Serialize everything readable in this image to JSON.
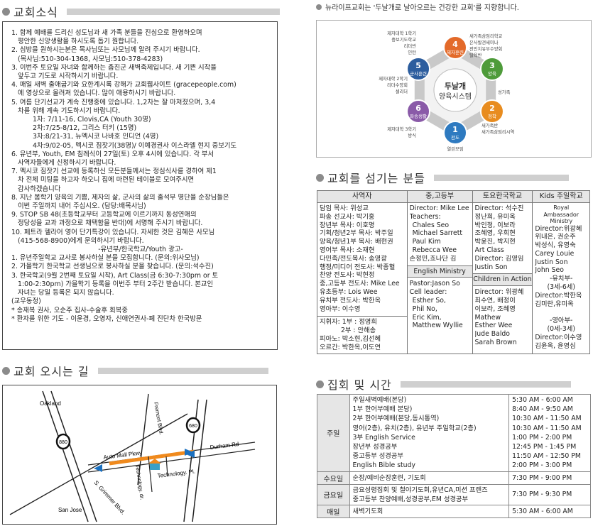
{
  "notices": {
    "title": "교회소식",
    "lines": [
      {
        "t": "1. 함께 예배를 드리신 성도님과 새 가족 분들을 진심으로 환영하오며",
        "i": 0
      },
      {
        "t": "평안한 신앙생활을 하시도록 돕기 원합니다.",
        "i": 1
      },
      {
        "t": "2. 심방을 원하시는분은 목사님또는 사모님께 알려 주시기 바랍니다.",
        "i": 0
      },
      {
        "t": "(목사님:510-304-1368, 사모님:510-378-4283)",
        "i": 1
      },
      {
        "t": "3. 이번주 토요일 자녀와 함께하는 촘진군 새벽축제입니다. 새 기쁜 시작을",
        "i": 0
      },
      {
        "t": "앞두고 기도로 시작하시기 바랍니다.",
        "i": 1
      },
      {
        "t": "4. 매일 새벽 출애굽기와 요한계시록 강해가 교회웹사이트 (gracepeople.com)",
        "i": 0
      },
      {
        "t": "에 영상으로 올려져 있습니다. 많이 애용하시기 바랍니다.",
        "i": 1
      },
      {
        "t": "5. 여름 단기선교가 계속 진행중에 있습니다. 1,2차는 잘 마쳐졌으며, 3,4",
        "i": 0
      },
      {
        "t": "차를 위해 계속 기도하시기 바랍니다.",
        "i": 1
      },
      {
        "t": "1차: 7/11-16, Clovis,CA (Youth 30명)",
        "i": 2
      },
      {
        "t": "2차:7/25-8/12, 그리스 터키 (15명)",
        "i": 2
      },
      {
        "t": "3차:8/21-31, 뉴멕시코 나바호 인디언 (4명)",
        "i": 2
      },
      {
        "t": "4차:9/02-05, 멕시코 짐잣기(38명)/ 이예경권사 이스라엘 현지 중보기도",
        "i": 2
      },
      {
        "t": "6. 유년부, Youth, EM 침례식이 27일(토) 오후 4시에 있습니다. 각 부서",
        "i": 0
      },
      {
        "t": "사역자들에게 신청하시기 바랍니다.",
        "i": 1
      },
      {
        "t": "7. 멕시코 짐잣기 선교에 등록하신 모든분들께서는 정심식사를 경하여 제1",
        "i": 0
      },
      {
        "t": "차 전체 미팅을 하고자 하오니 집에 마련된 테이블로 모여주시면",
        "i": 1
      },
      {
        "t": "감사하겠습니다",
        "i": 1
      },
      {
        "t": "8. 지난 봄학기 양육의 기쁨, 제자의 삶, 군사의 삶의 출석부 명단을 순장님들은",
        "i": 0
      },
      {
        "t": "이번 주일까지 내어 주십시오. (담당:배목사님)",
        "i": 1
      },
      {
        "t": "9. STOP SB 48(초등학교부터 고등학교에 이르기까지 동성연애의",
        "i": 0
      },
      {
        "t": "정당성을 교과 과정으로 채택함을 반대)에 서명해 주시기 바랍니다.",
        "i": 1
      },
      {
        "t": "10. 페트라 헬라어 영어 단기특강이 있습니다. 자세한 것은 김혜은 사모님",
        "i": 0
      },
      {
        "t": "(415-568-8900)에게 문의하시기 바랍니다.",
        "i": 1
      },
      {
        "t": "-유년부/한국학교/Youth 광고-",
        "i": 3
      },
      {
        "t": "1. 유년주일학교 교사로 봉사하실 분을 모집합니다. (문의:위사모님)",
        "i": 0
      },
      {
        "t": "2. 가을학기 한국학교 선생님으로 봉사하실 분을 찾습니다. (문의:석수진)",
        "i": 0
      },
      {
        "t": "3. 한국학교(9월 2번째 토요일 시작), Art Class(금 6:30-7:30pm or 토",
        "i": 0
      },
      {
        "t": "1:00-2:30pm) 가을학기 등록을 이번주 부터 2주간 받습니다. 본교인",
        "i": 1
      },
      {
        "t": "자녀는 당일 등록은 되지 않습니다.",
        "i": 1
      },
      {
        "t": "(교우동정)",
        "i": 0
      },
      {
        "t": "* 송재복 권사, 오순주 집사-수술후 회복중",
        "i": 0
      },
      {
        "t": "* 환자를 위한 기도 - 이윤경, 오영자, 신애연권사-폐 진단차 한국방문",
        "i": 0
      }
    ]
  },
  "directions": {
    "title": "교회 오시는 길",
    "labels": {
      "oakland": "Oakland",
      "san_jose": "San Jose",
      "fremont": "Fremont Blvd.",
      "auto_mall": "Auto Mall Pkwy",
      "durham": "Durham Rd",
      "technology_pl": "Technology. Pl.",
      "technology_dr": "Technology. dr.",
      "grimmer": "S. Grimmer Blvd.",
      "hwy880": "880",
      "hwy680": "680"
    }
  },
  "vision": {
    "text": "뉴라이프교회는 '두날개로 날아오르는 건강한 교회'를 지향합니다.",
    "center_line1": "두날개",
    "center_line2": "양육시스템",
    "nodes": [
      {
        "num": "1",
        "label": "전도",
        "color": "#2e7ac0"
      },
      {
        "num": "2",
        "label": "정착",
        "color": "#e88c1f"
      },
      {
        "num": "3",
        "label": "양육",
        "color": "#4e9b3a"
      },
      {
        "num": "4",
        "label": "제자훈련",
        "color": "#e36a2a"
      },
      {
        "num": "5",
        "label": "군사훈련",
        "color": "#2c5d9e"
      },
      {
        "num": "6",
        "label": "파송생활",
        "color": "#8a5aa8"
      }
    ],
    "captions": {
      "bottom": "열린모임",
      "bottom_right": "새가족반\n새가족삼임리시역",
      "right_top": "성가족",
      "top_right": "새가족삼임리학교\n은사발견세미나\n전인치유무수양회\n탈육반",
      "top_left": "제자대학 1학기\n중보기도학교\n리더반\n인턴",
      "left": "제자대학 2학기\n리더수양회\n셀리더",
      "bottom_left": "제자대학 3학기\n방식"
    }
  },
  "staff": {
    "title": "교회를 섬기는 분들",
    "headers": [
      "사역자",
      "중,고등부",
      "토요한국학교",
      "Kids 주일학교"
    ],
    "col1_top": [
      "담임 목사: 위성교",
      "파송 선교사: 박기홍",
      "장년부 목사: 이호명",
      "기획/청년2부 목사: 박주일",
      "양육/청년1부 목사: 배현권",
      "영어부 목사: 소재현",
      "다민족/전도목사: 송영광",
      "행정/미디어 전도사: 박종혈",
      "찬양 전도사: 박현정",
      "중,고등부 전도사: Mike Lee",
      "유초등부: Lois Wee",
      "유치부 전도사: 박한옥",
      "영아부: 이수영"
    ],
    "col1_bottom": [
      "지휘자: 1부 : 정영희",
      "2부 : 안해송",
      "피아노: 박소현,김선혜",
      "오르간: 박한옥,이도연"
    ],
    "col2_top": [
      "Director: Mike Lee",
      "Teachers:",
      "Chales Seo",
      "Michael Sarrett",
      "Paul Kim",
      "Rebecca Wee",
      "손정민,죠나단 김"
    ],
    "col2_sub": "English Ministry",
    "col2_bottom": [
      "Pastor:Jason So",
      "Cell leader:",
      "Esther So,",
      "Phil No,",
      "Eric Kim,",
      "Matthew Wyllie"
    ],
    "col3_top": [
      "Director: 석수진",
      "정난희, 유미옥",
      "박인정, 이보라",
      "조혜영, 우희현",
      "박윤진, 박지현",
      "Art Class",
      "Director: 김영임",
      "Justin Son"
    ],
    "col3_sub": "Children in Action",
    "col3_bottom": [
      "Director: 위광혜",
      "최수연, 배정이",
      "이보라, 조혜영",
      "Mathew",
      "Esther Wee",
      "Jude Baldo",
      "Sarah Brown"
    ],
    "col4_hdr": [
      "Royal Ambassador",
      "Ministry"
    ],
    "col4": [
      "Director:위광혜",
      "위내은, 권순주",
      "박성식, 유영숙",
      "Carey Louie",
      "Justin Son",
      "John Seo",
      "-유치부-",
      "(3세-6세)",
      "Director:박한옥",
      "김미란,유미옥",
      "",
      "-영아부-",
      "(0세-3세)",
      "Director:이수영",
      "김윤옥, 윤영심"
    ]
  },
  "services": {
    "title": "집회 및 시간",
    "rows": [
      {
        "day": "주일",
        "items": [
          "주일새벽예배(본당)",
          "1부 한어부예배 본당)",
          "2부 한어부예배(본당,동시통역)",
          "영어(2층), 유치(2층), 유년부 주일학교(2층)",
          "3부 English Service",
          "장년부 성경공부",
          "중고등부 성경공부",
          "English Bible study"
        ],
        "times": [
          "5:30 AM - 6:00 AM",
          "8:40 AM - 9:50 AM",
          "10:30 AM - 11:50 AM",
          "10:30 AM - 11:50 AM",
          "1:00 PM - 2:00 PM",
          "12:45 PM - 1:45 PM",
          "11:50 AM - 12:50 PM",
          "2:00 PM - 3:00 PM"
        ]
      },
      {
        "day": "수요일",
        "items": [
          "순장/예비순장훈련, 기도회"
        ],
        "times": [
          "7:30 PM - 9:00 PM"
        ]
      },
      {
        "day": "금요일",
        "items": [
          "금요성령집회 및 철야기도회,유년CA,미션 프렌즈",
          "중고등부 찬양예배,성경공부,EM 성경공부"
        ],
        "times": [
          "7:30 PM - 9:30 PM"
        ]
      },
      {
        "day": "매일",
        "items": [
          "새벽기도회"
        ],
        "times": [
          "5:30 AM - 6:00 AM"
        ]
      }
    ]
  }
}
